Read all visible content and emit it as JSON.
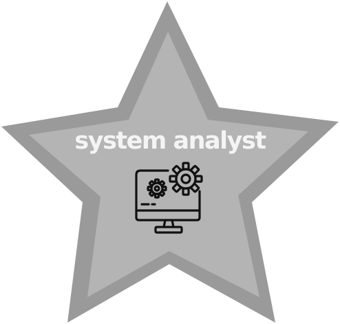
{
  "badge": {
    "title": "system analyst",
    "icon": "computer-settings-icon",
    "shape": "star"
  },
  "colors": {
    "star_outer": "#9a9a9a",
    "star_inner": "#b4b4b4",
    "title_text": "#f4f4f4",
    "icon_stroke": "#111111"
  }
}
